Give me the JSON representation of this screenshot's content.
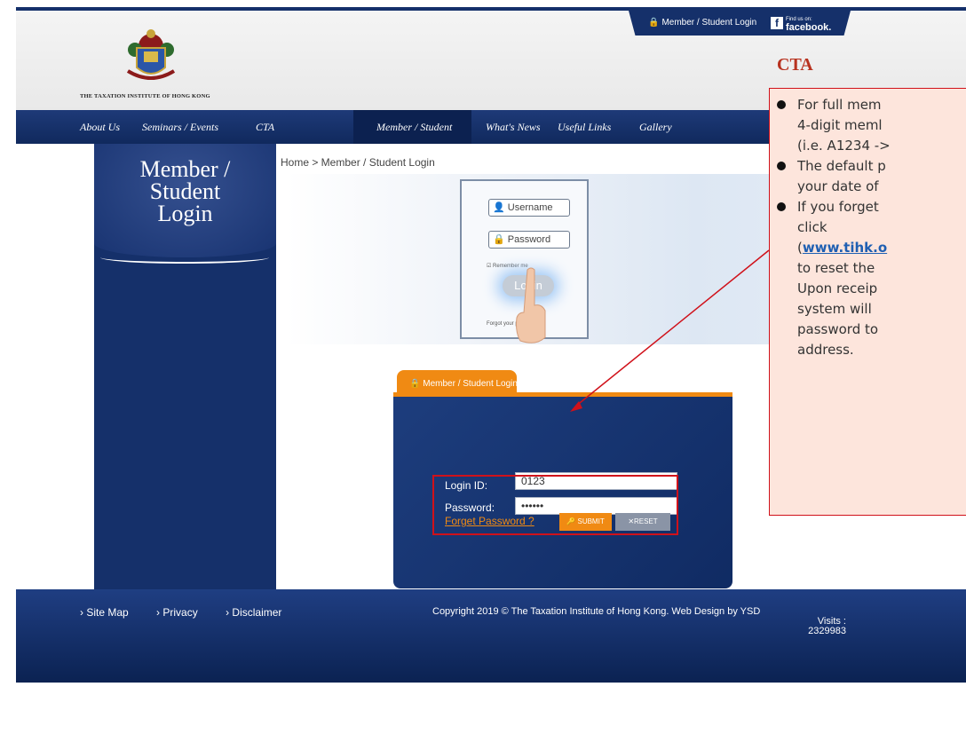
{
  "top": {
    "member_login": "Member / Student Login",
    "facebook_small": "Find us on:",
    "facebook": "facebook."
  },
  "header": {
    "logo_text": "THE TAXATION INSTITUTE OF HONG KONG",
    "cta_brand": "CTA"
  },
  "nav": {
    "items": [
      "About Us",
      "Seminars / Events",
      "CTA",
      "Member / Student",
      "What's News",
      "Useful Links",
      "Gallery"
    ],
    "active": "Member / Student"
  },
  "sidebar": {
    "title_1": "Member /",
    "title_2": "Student",
    "title_3": "Login"
  },
  "breadcrumb": "Home > Member / Student Login",
  "banner": {
    "username": "Username",
    "password": "Password",
    "remember": "Remember me",
    "login": "Login",
    "forgot": "Forgot your password?"
  },
  "login": {
    "tab_label": "Member / Student Login",
    "id_label": "Login ID:",
    "id_value": "0123",
    "password_label": "Password:",
    "password_value": "••••••",
    "forget": "Forget Password ?",
    "submit": "SUBMIT",
    "reset": "RESET"
  },
  "footer": {
    "links": [
      "Site Map",
      "Privacy",
      "Disclaimer"
    ],
    "copyright": "Copyright 2019 © The Taxation Institute of Hong Kong. Web Design by YSD",
    "visits_label": "Visits :",
    "visits_value": "2329983"
  },
  "callout": {
    "l1": "For full mem",
    "l2": "4-digit meml",
    "l3": "(i.e. A1234 ->",
    "l4": "The default p",
    "l5": "your date of",
    "l6": "If you forget",
    "l7": "click",
    "l8_paren": "(",
    "l8_link": "www.tihk.o",
    "l9": "to reset the",
    "l10": "Upon receip",
    "l11": "system will",
    "l12": "password to",
    "l13": "address."
  },
  "colors": {
    "navy": "#15306a",
    "orange": "#f08a13",
    "red": "#d0111a",
    "callout_bg": "#fde5dc"
  }
}
